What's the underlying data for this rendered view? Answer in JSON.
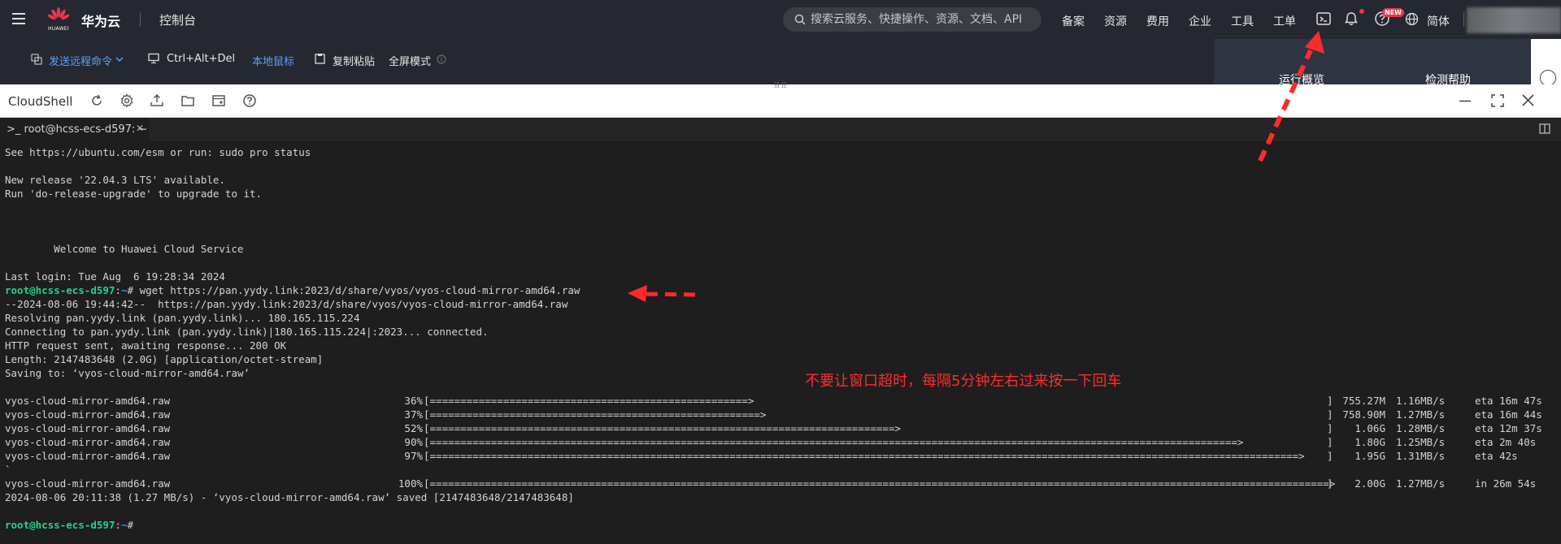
{
  "nav": {
    "brand": "华为云",
    "logo_text": "HUAWEI",
    "console": "控制台",
    "search_placeholder": "搜索云服务、快捷操作、资源、文档、API",
    "links": [
      "备案",
      "资源",
      "费用",
      "企业",
      "工具",
      "工单"
    ],
    "new_badge": "NEW",
    "lang": "简体"
  },
  "toolbar": {
    "send_remote": "发送远程命令",
    "ctrl_alt_del": "Ctrl+Alt+Del",
    "local_mouse": "本地鼠标",
    "copy_paste": "复制粘贴",
    "fullscreen": "全屏模式"
  },
  "right_tabs": [
    "运行概览",
    "检测帮助"
  ],
  "cloudshell": {
    "title": "CloudShell",
    "tab_label": "root@hcss-ecs-d597: ~"
  },
  "terminal": {
    "esm": "See https://ubuntu.com/esm or run: sudo pro status",
    "release": "New release '22.04.3 LTS' available.",
    "upgrade": "Run 'do-release-upgrade' to upgrade to it.",
    "welcome": "        Welcome to Huawei Cloud Service",
    "last_login": "Last login: Tue Aug  6 19:28:34 2024",
    "prompt_user": "root@hcss-ecs-d597",
    "prompt_path": "~",
    "prompt_sep": ":",
    "prompt_end": "#",
    "command": " wget https://pan.yydy.link:2023/d/share/vyos/vyos-cloud-mirror-amd64.raw",
    "out": [
      "--2024-08-06 19:44:42--  https://pan.yydy.link:2023/d/share/vyos/vyos-cloud-mirror-amd64.raw",
      "Resolving pan.yydy.link (pan.yydy.link)... 180.165.115.224",
      "Connecting to pan.yydy.link (pan.yydy.link)|180.165.115.224|:2023... connected.",
      "HTTP request sent, awaiting response... 200 OK",
      "Length: 2147483648 (2.0G) [application/octet-stream]",
      "Saving to: ‘vyos-cloud-mirror-amd64.raw’"
    ],
    "progress": [
      {
        "file": "vyos-cloud-mirror-amd64.raw",
        "pct": "36%",
        "pct_value": 36,
        "size": "755.27M",
        "speed": "1.16MB/s",
        "eta": "eta 16m 47s"
      },
      {
        "file": "vyos-cloud-mirror-amd64.raw",
        "pct": "37%",
        "pct_value": 37,
        "size": "758.90M",
        "speed": "1.27MB/s",
        "eta": "eta 16m 44s"
      },
      {
        "file": "vyos-cloud-mirror-amd64.raw",
        "pct": "52%",
        "pct_value": 52,
        "size": "1.06G",
        "speed": "1.28MB/s",
        "eta": "eta 12m 37s"
      },
      {
        "file": "vyos-cloud-mirror-amd64.raw",
        "pct": "90%",
        "pct_value": 90,
        "size": "1.80G",
        "speed": "1.25MB/s",
        "eta": "eta 2m 40s"
      },
      {
        "file": "vyos-cloud-mirror-amd64.raw",
        "pct": "97%",
        "pct_value": 97,
        "size": "1.95G",
        "speed": "1.31MB/s",
        "eta": "eta 42s"
      }
    ],
    "stray": "`",
    "final": {
      "file": "vyos-cloud-mirror-amd64.raw",
      "pct": "100%",
      "pct_value": 100,
      "size": "2.00G",
      "speed": "1.27MB/s",
      "eta": "in 26m 54s"
    },
    "saved": "2024-08-06 20:11:38 (1.27 MB/s) - ‘vyos-cloud-mirror-amd64.raw’ saved [2147483648/2147483648]"
  },
  "annotation": "不要让窗口超时，每隔5分钟左右过来按一下回车",
  "colors": {
    "accent": "#5aa0ff",
    "prompt_green": "#23d18b",
    "prompt_blue": "#3b8eea",
    "annotation_red": "#ff2b2b"
  }
}
